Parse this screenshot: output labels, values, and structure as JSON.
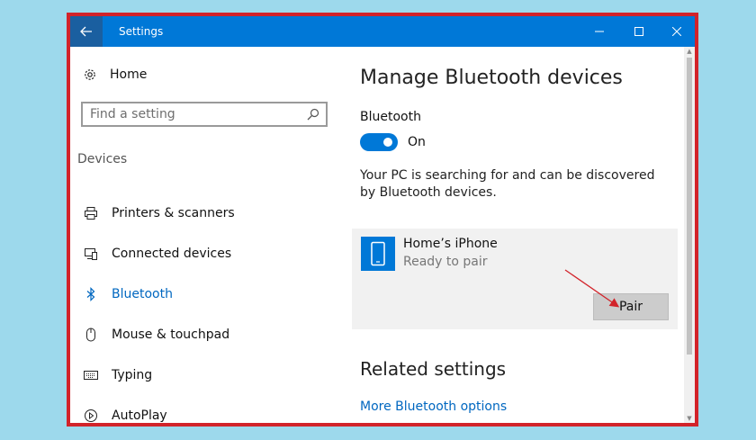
{
  "window": {
    "title": "Settings",
    "controls": [
      "minimize",
      "maximize",
      "close"
    ]
  },
  "sidebar": {
    "home_label": "Home",
    "search_placeholder": "Find a setting",
    "section_label": "Devices",
    "items": [
      {
        "label": "Printers & scanners",
        "icon": "printer-icon"
      },
      {
        "label": "Connected devices",
        "icon": "connected-devices-icon"
      },
      {
        "label": "Bluetooth",
        "icon": "bluetooth-icon",
        "active": true
      },
      {
        "label": "Mouse & touchpad",
        "icon": "mouse-icon"
      },
      {
        "label": "Typing",
        "icon": "keyboard-icon"
      },
      {
        "label": "AutoPlay",
        "icon": "autoplay-icon"
      }
    ]
  },
  "main": {
    "title": "Manage Bluetooth devices",
    "bluetooth_label": "Bluetooth",
    "toggle_state": "On",
    "toggle_on": true,
    "description": "Your PC is searching for and can be discovered by Bluetooth devices.",
    "device": {
      "name": "Home’s iPhone",
      "status": "Ready to pair",
      "button_label": "Pair",
      "icon": "phone-icon"
    },
    "related_title": "Related settings",
    "related_link": "More Bluetooth options"
  },
  "colors": {
    "accent": "#0078d7",
    "link": "#0067c0",
    "highlight_border": "#d2232a",
    "background": "#9dd9ec",
    "card": "#f1f1f1"
  }
}
